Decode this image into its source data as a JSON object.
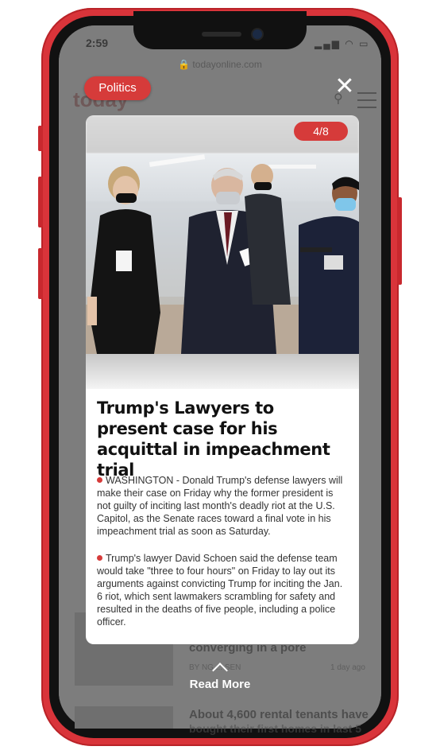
{
  "status": {
    "time": "2:59",
    "icons": "▂▄▆ ◠ ▭"
  },
  "browser": {
    "url": "🔒 todayonline.com"
  },
  "background": {
    "logo": "today",
    "headline_1": "converging in a pore",
    "meta_1": "BY NG  ... SEN",
    "time_1": "1 day ago",
    "headline_2": "About 4,600 rental tenants have",
    "headline_2b": "bought their first homes in last 5"
  },
  "overlay": {
    "category": "Politics",
    "close_icon": "close-icon",
    "counter": "4/8",
    "read_more": "Read More"
  },
  "article": {
    "headline": "Trump's Lawyers to present case for his acquittal in impeachment trial",
    "paragraphs": [
      "WASHINGTON - Donald Trump's defense lawyers will make their case on Friday why the former president is not guilty of inciting last month's deadly riot at the U.S. Capitol, as the Senate races toward a final vote in his impeachment trial as soon as Saturday.",
      "Trump's lawyer David Schoen said the defense team would take \"three to four hours\" on Friday to lay out its arguments against convicting Trump for inciting the Jan. 6 riot, which sent lawmakers scrambling for safety and resulted in the deaths of five people, including a police officer."
    ]
  },
  "colors": {
    "accent": "#d63b3a",
    "frame": "#d9343a"
  }
}
